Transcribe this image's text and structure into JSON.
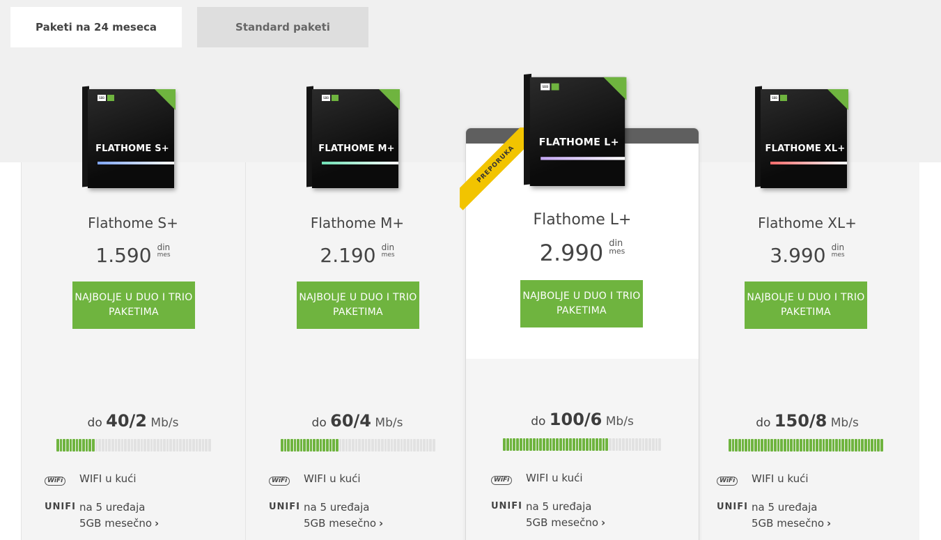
{
  "tabs": [
    {
      "label": "Paketi na 24 meseca",
      "active": true
    },
    {
      "label": "Standard paketi",
      "active": false
    }
  ],
  "colors": {
    "accent_green": "#6fb43f",
    "ribbon_yellow": "#f2c400",
    "tab_inactive_bg": "#dedede",
    "card_bg": "#f4f4f4"
  },
  "plans": [
    {
      "box_label": "FLATHOME S+",
      "name": "Flathome S+",
      "price": "1.590",
      "currency": "din",
      "period": "mes",
      "cta": "NAJBOLJE U DUO I TRIO PAKETIMA",
      "speed_prefix": "do",
      "speed": "40/2",
      "speed_unit": "Mb/s",
      "speed_level": 0.25,
      "stripe_color": "#7fa6ff",
      "wifi_text": "WIFI u kući",
      "unifi_line1": "na 5 uređaja",
      "unifi_line2": "5GB mesečno"
    },
    {
      "box_label": "FLATHOME M+",
      "name": "Flathome M+",
      "price": "2.190",
      "currency": "din",
      "period": "mes",
      "cta": "NAJBOLJE U DUO I TRIO PAKETIMA",
      "speed_prefix": "do",
      "speed": "60/4",
      "speed_unit": "Mb/s",
      "speed_level": 0.37,
      "stripe_color": "#6fe0b5",
      "wifi_text": "WIFI u kući",
      "unifi_line1": "na 5 uređaja",
      "unifi_line2": "5GB mesečno"
    },
    {
      "box_label": "FLATHOME L+",
      "name": "Flathome L+",
      "price": "2.990",
      "currency": "din",
      "period": "mes",
      "cta": "NAJBOLJE U DUO I TRIO PAKETIMA",
      "speed_prefix": "do",
      "speed": "100/6",
      "speed_unit": "Mb/s",
      "speed_level": 0.67,
      "stripe_color": "#c3a6f2",
      "ribbon": "PREPORUKA",
      "wifi_text": "WIFI u kući",
      "unifi_line1": "na 5 uređaja",
      "unifi_line2": "5GB mesečno"
    },
    {
      "box_label": "FLATHOME XL+",
      "name": "Flathome XL+",
      "price": "3.990",
      "currency": "din",
      "period": "mes",
      "cta": "NAJBOLJE U DUO I TRIO PAKETIMA",
      "speed_prefix": "do",
      "speed": "150/8",
      "speed_unit": "Mb/s",
      "speed_level": 1.0,
      "stripe_color": "#ff6b6b",
      "wifi_text": "WIFI u kući",
      "unifi_line1": "na 5 uređaja",
      "unifi_line2": "5GB mesečno"
    }
  ],
  "icons": {
    "wifi": "wifi-badge-icon",
    "unifi": "unifi-logo-icon",
    "chevron": "chevron-right-icon"
  },
  "icon_text": {
    "wifi": "WiFi",
    "unifi": "UNIFI",
    "chevron": "›",
    "box_logo": "SBB"
  }
}
